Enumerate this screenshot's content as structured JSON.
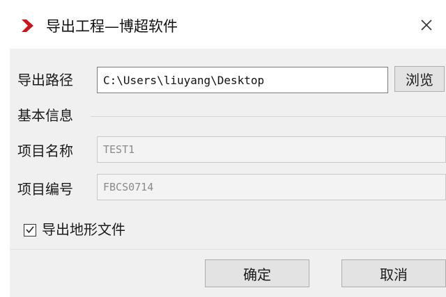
{
  "window": {
    "title": "导出工程—博超软件",
    "close_symbol": "×",
    "accent_color": "#c8161d"
  },
  "export_path": {
    "label": "导出路径",
    "value": "C:\\Users\\liuyang\\Desktop",
    "browse_label": "浏览"
  },
  "basic_info": {
    "group_label": "基本信息",
    "project_name_label": "项目名称",
    "project_name_value": "TEST1",
    "project_code_label": "项目编号",
    "project_code_value": "FBCS0714"
  },
  "options": {
    "export_terrain_label": "导出地形文件",
    "export_terrain_checked": true
  },
  "footer": {
    "ok_label": "确定",
    "cancel_label": "取消"
  },
  "icons": {
    "app": "app-logo-icon",
    "close": "close-icon",
    "check": "checkmark-icon"
  }
}
